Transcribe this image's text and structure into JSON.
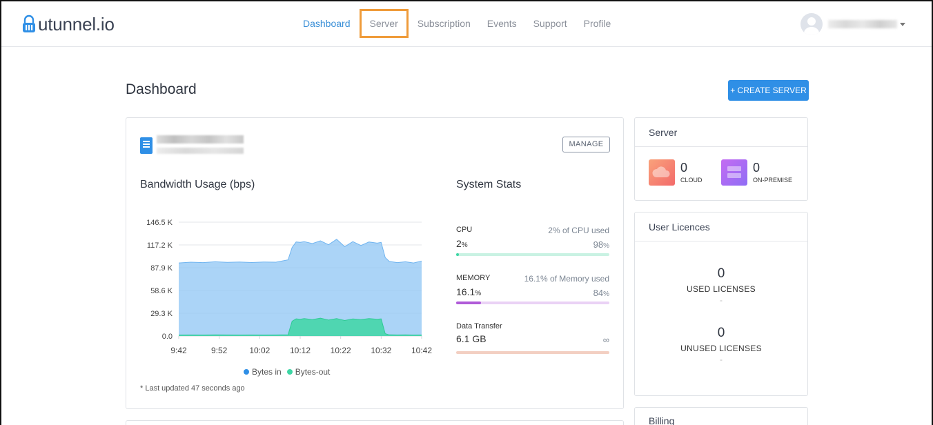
{
  "app": {
    "logo_text": "utunnel.io"
  },
  "nav": {
    "links": [
      "Dashboard",
      "Server",
      "Subscription",
      "Events",
      "Support",
      "Profile"
    ],
    "active": "Dashboard",
    "highlighted": "Server"
  },
  "page": {
    "title": "Dashboard",
    "create_button": "+ CREATE SERVER"
  },
  "server_card": {
    "manage_button": "MANAGE",
    "bandwidth_title": "Bandwidth Usage (bps)",
    "system_stats_title": "System Stats",
    "legend": {
      "bytes_in": "Bytes in",
      "bytes_out": "Bytes-out"
    },
    "last_updated": "* Last updated 47 seconds ago"
  },
  "chart_data": {
    "type": "area",
    "title": "Bandwidth Usage (bps)",
    "x_ticks": [
      "9:42",
      "9:52",
      "10:02",
      "10:12",
      "10:22",
      "10:32",
      "10:42"
    ],
    "y_ticks": [
      "0.0",
      "29.3 K",
      "58.6 K",
      "87.9 K",
      "117.2 K",
      "146.5 K"
    ],
    "ylim": [
      0,
      146500
    ],
    "x_minutes": [
      0,
      3,
      6,
      9,
      12,
      15,
      18,
      21,
      24,
      27,
      28,
      29,
      30,
      31,
      33,
      35,
      37,
      39,
      41,
      43,
      45,
      47,
      49,
      50,
      51,
      52,
      54,
      56,
      58,
      60
    ],
    "series": [
      {
        "name": "Bytes in",
        "color": "#8fc5f4",
        "values": [
          94000,
          95000,
          94500,
          95500,
          94800,
          95200,
          94600,
          95300,
          95000,
          98000,
          114000,
          121000,
          120500,
          121500,
          119000,
          122500,
          117500,
          124500,
          115000,
          121500,
          116500,
          121000,
          119500,
          120500,
          101000,
          96000,
          94500,
          95500,
          94000,
          96500
        ]
      },
      {
        "name": "Bytes-out",
        "color": "#3ed6a5",
        "values": [
          1200,
          1300,
          1200,
          1400,
          1300,
          1200,
          1300,
          1200,
          1300,
          1500,
          19000,
          22000,
          21500,
          22500,
          21000,
          23000,
          20500,
          22500,
          20000,
          22000,
          21000,
          22500,
          21500,
          22000,
          3000,
          1500,
          1300,
          1400,
          1200,
          1300
        ]
      }
    ],
    "grid": true,
    "legend": "bottom"
  },
  "stats": {
    "cpu": {
      "label": "CPU",
      "value": "2",
      "unit": "%",
      "used_text": "2% of CPU used",
      "free_value": "98",
      "free_unit": "%",
      "percent": 2,
      "color": "#3ed6a5",
      "track": "#c9f2e3"
    },
    "memory": {
      "label": "MEMORY",
      "value": "16.1",
      "unit": "%",
      "used_text": "16.1% of Memory used",
      "free_value": "84",
      "free_unit": "%",
      "percent": 16.1,
      "color": "#b05bd8",
      "track": "#ead2f5"
    },
    "transfer": {
      "label": "Data Transfer",
      "value": "6.1 GB",
      "right": "∞",
      "color": "#f3cfc2"
    }
  },
  "server_panel": {
    "title": "Server",
    "cloud": {
      "count": "0",
      "label": "CLOUD"
    },
    "on_premise": {
      "count": "0",
      "label": "ON-PREMISE"
    }
  },
  "licences_panel": {
    "title": "User Licences",
    "used": {
      "count": "0",
      "label": "USED LICENSES",
      "dash": "-"
    },
    "unused": {
      "count": "0",
      "label": "UNUSED LICENSES",
      "dash": "-"
    }
  },
  "billing_panel": {
    "title": "Billing"
  }
}
